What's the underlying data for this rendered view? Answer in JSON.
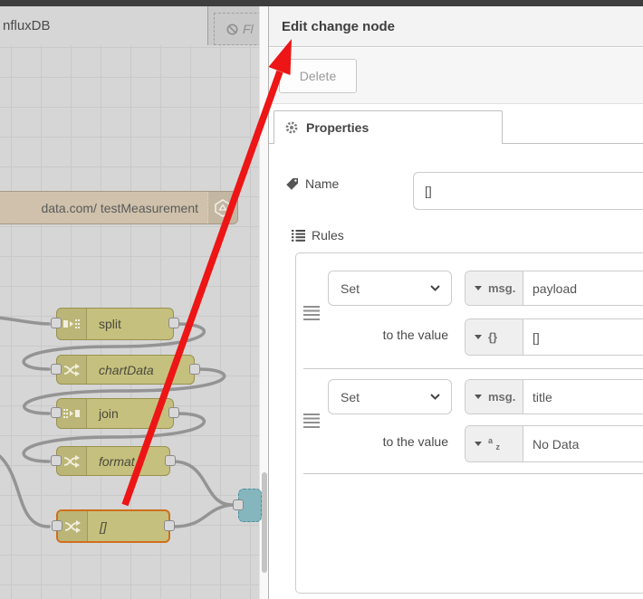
{
  "workspace": {
    "tabs": [
      {
        "label": "nfluxDB",
        "state": "active"
      },
      {
        "label": "Fl",
        "state": "disabled"
      }
    ],
    "nodes": [
      {
        "label": "data.com/ testMeasurement",
        "type": "influxdb-out"
      },
      {
        "label": "split",
        "type": "split"
      },
      {
        "label": "chartData",
        "type": "change"
      },
      {
        "label": "join",
        "type": "join"
      },
      {
        "label": "format",
        "type": "change"
      },
      {
        "label": "[]",
        "type": "change",
        "selected": true
      }
    ]
  },
  "tray": {
    "title": "Edit change node",
    "delete_label": "Delete",
    "properties_tab": "Properties",
    "form": {
      "name_label": "Name",
      "name_value": "[]",
      "rules_label": "Rules",
      "rules": [
        {
          "action": "Set",
          "prop_type": "msg.",
          "property": "payload",
          "to_label": "to the value",
          "value_type": "{}",
          "value": "[]"
        },
        {
          "action": "Set",
          "prop_type": "msg.",
          "property": "title",
          "to_label": "to the value",
          "value_type_top": "a",
          "value_type_bottom": "z",
          "value": "No Data"
        }
      ]
    }
  },
  "colors": {
    "annotation_arrow": "#ed1515",
    "node_khaki": "#c6c07e",
    "node_selected_border": "#cf6f1e",
    "node_influx": "#cfc1ab",
    "node_teal": "#85b6be",
    "wire": "#949494",
    "topbar": "#3e3e3e"
  }
}
